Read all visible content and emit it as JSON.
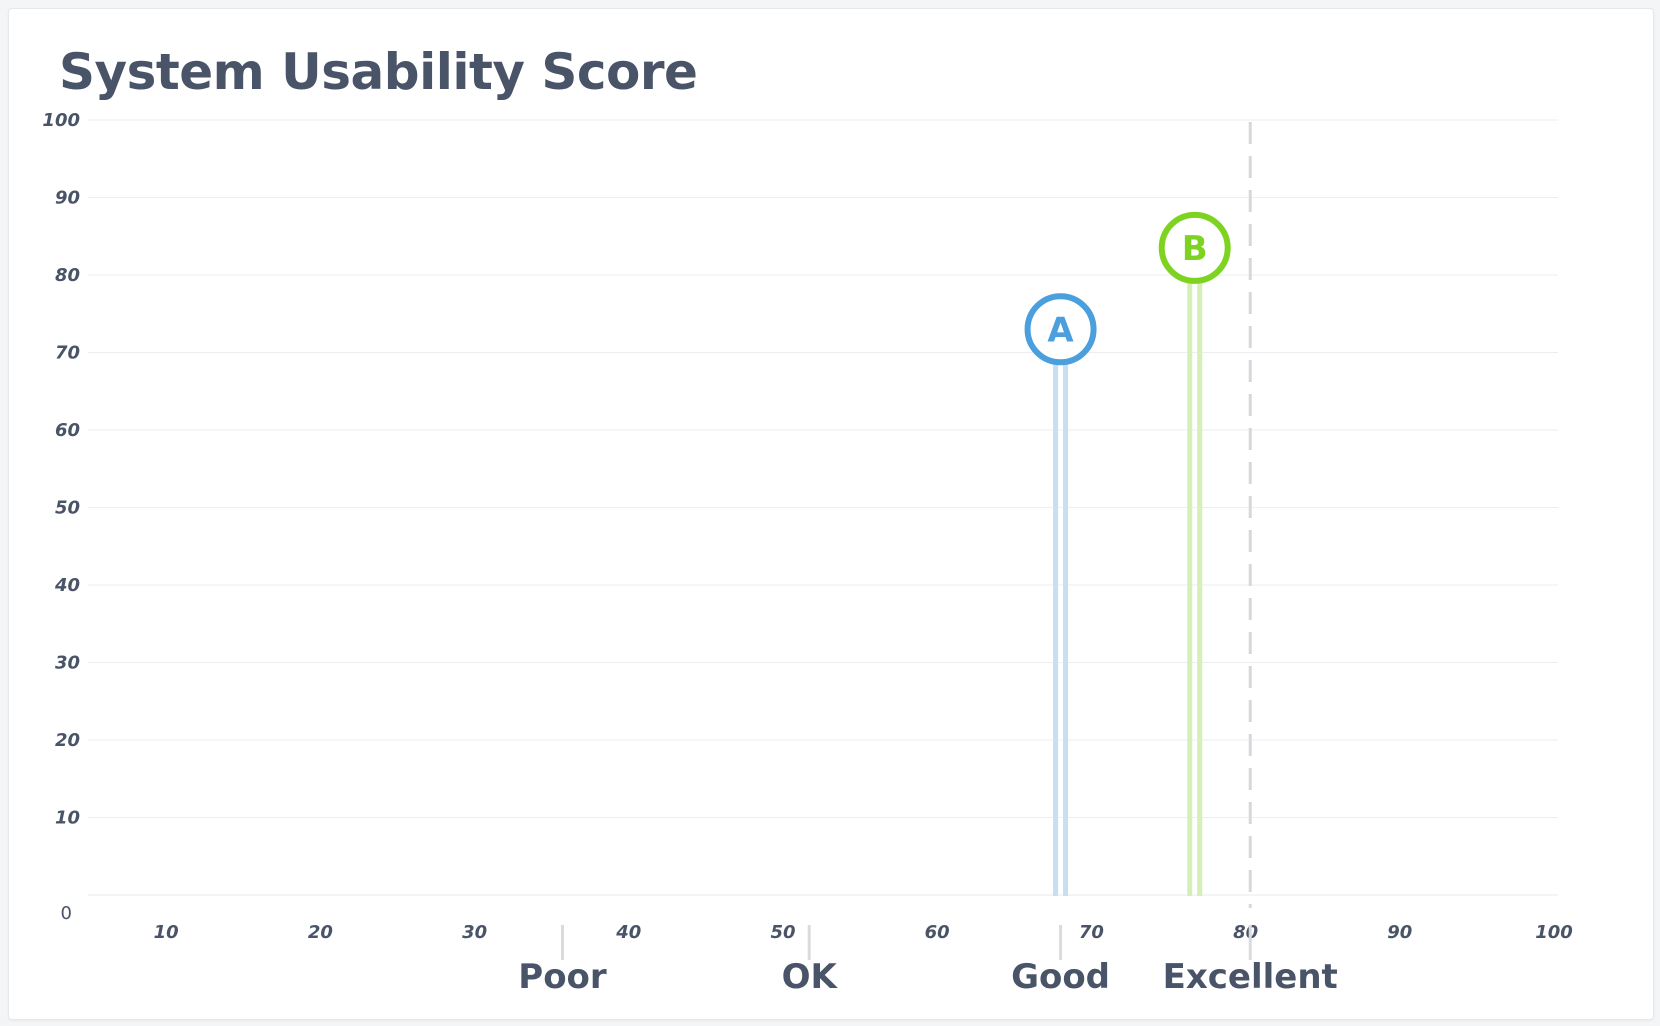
{
  "chart_data": {
    "type": "scatter",
    "title": "System Usability Score",
    "xlim": [
      0,
      100
    ],
    "ylim": [
      0,
      100
    ],
    "x_ticks": [
      10,
      20,
      30,
      40,
      50,
      60,
      70,
      80,
      90,
      100
    ],
    "y_ticks": [
      10,
      20,
      30,
      40,
      50,
      60,
      70,
      80,
      90,
      100
    ],
    "zero_label": "0",
    "grid": true,
    "series": [
      {
        "label": "A",
        "x": 68,
        "y": 73,
        "color": "#4a9fdc",
        "stem_color": "#c6dff3"
      },
      {
        "label": "B",
        "x": 76.7,
        "y": 83.5,
        "color": "#7ed321",
        "stem_color": "#d4f0b8"
      }
    ],
    "bands": [
      {
        "label": "Poor",
        "x": 35.7
      },
      {
        "label": "OK",
        "x": 51.7
      },
      {
        "label": "Good",
        "x": 68
      },
      {
        "label": "Excellent",
        "x": 80.3
      }
    ],
    "reference_line": {
      "x": 80.3,
      "style": "dashed"
    }
  }
}
